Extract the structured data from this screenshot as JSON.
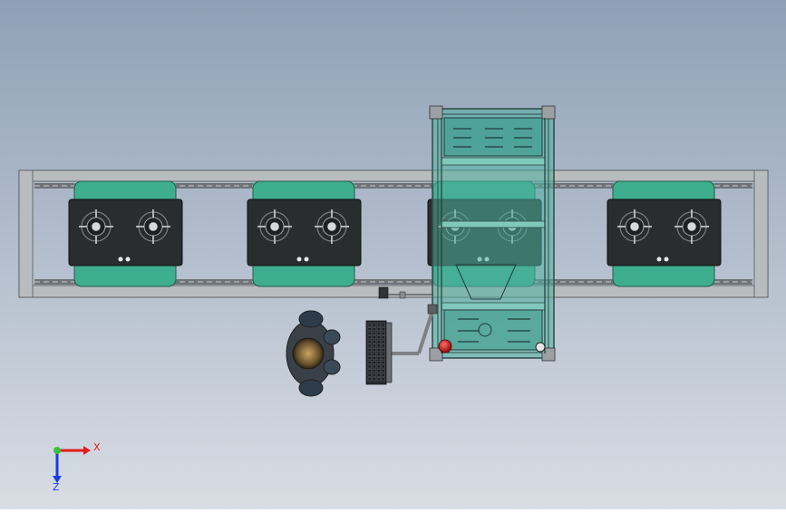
{
  "viewport": {
    "background_top": "#8fa0b6",
    "background_bottom": "#d8dde4"
  },
  "colors": {
    "frame": "#b9bcbf",
    "rail": "#6f7378",
    "cooktop_glass": "#2a2d2e",
    "cooktop_tray": "#3fae8e",
    "machine_glass": "#4eb0a0",
    "machine_edge": "#2c4b47",
    "emergency_button": "#cc1f1f",
    "axis_x": "#e11d1d",
    "axis_y": "#1d3be1",
    "axis_origin": "#3cbf3c"
  },
  "scene": {
    "cooktops": [
      {
        "id": "cooktop-1",
        "burners": 2
      },
      {
        "id": "cooktop-2",
        "burners": 2
      },
      {
        "id": "cooktop-3",
        "burners": 2
      },
      {
        "id": "cooktop-4",
        "burners": 2
      }
    ],
    "robot_gantry": {
      "covered_cooktop": "cooktop-3"
    },
    "operator": {
      "present": true
    },
    "keyboard": {
      "present": true
    },
    "control_arm": {
      "present": true
    }
  },
  "triad": {
    "x_label": "X",
    "z_label": "Z"
  }
}
